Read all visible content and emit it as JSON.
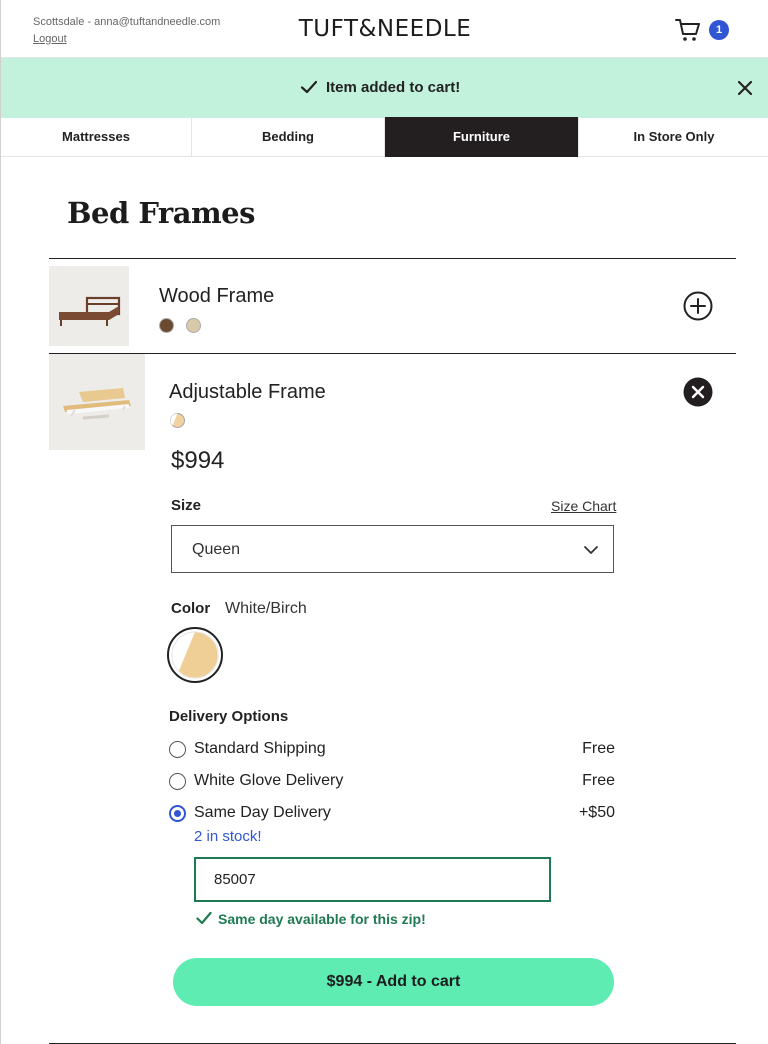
{
  "header": {
    "account": "Scottsdale - anna@tuftandneedle.com",
    "logout": "Logout",
    "logo": "TUFT&NEEDLE",
    "cart_count": "1"
  },
  "toast": {
    "message": "Item added to cart!"
  },
  "nav": {
    "tabs": [
      {
        "label": "Mattresses",
        "active": false
      },
      {
        "label": "Bedding",
        "active": false
      },
      {
        "label": "Furniture",
        "active": true
      },
      {
        "label": "In Store Only",
        "active": false
      }
    ]
  },
  "section": {
    "title": "Bed Frames"
  },
  "products": [
    {
      "name": "Wood Frame",
      "swatches": [
        "#6b4a2f",
        "#d8c9a8"
      ],
      "expanded": false
    },
    {
      "name": "Adjustable Frame",
      "swatches": [
        "white-birch"
      ],
      "expanded": true,
      "price": "$994",
      "size_label": "Size",
      "size_chart": "Size Chart",
      "size_value": "Queen",
      "color_label": "Color",
      "color_value": "White/Birch",
      "delivery_label": "Delivery Options",
      "delivery_options": [
        {
          "label": "Standard Shipping",
          "price": "Free",
          "selected": false
        },
        {
          "label": "White Glove Delivery",
          "price": "Free",
          "selected": false
        },
        {
          "label": "Same Day Delivery",
          "price": "+$50",
          "selected": true
        }
      ],
      "stock_note": "2 in stock!",
      "zip_value": "85007",
      "zip_confirm": "Same day available for this zip!",
      "add_to_cart": "$994 - Add to cart"
    }
  ],
  "colors": {
    "accent_blue": "#3056d3",
    "toast_bg": "#c2f2dc",
    "cta_green": "#5eecb3",
    "success_green": "#1f7a53",
    "tab_active_bg": "#231f20"
  }
}
